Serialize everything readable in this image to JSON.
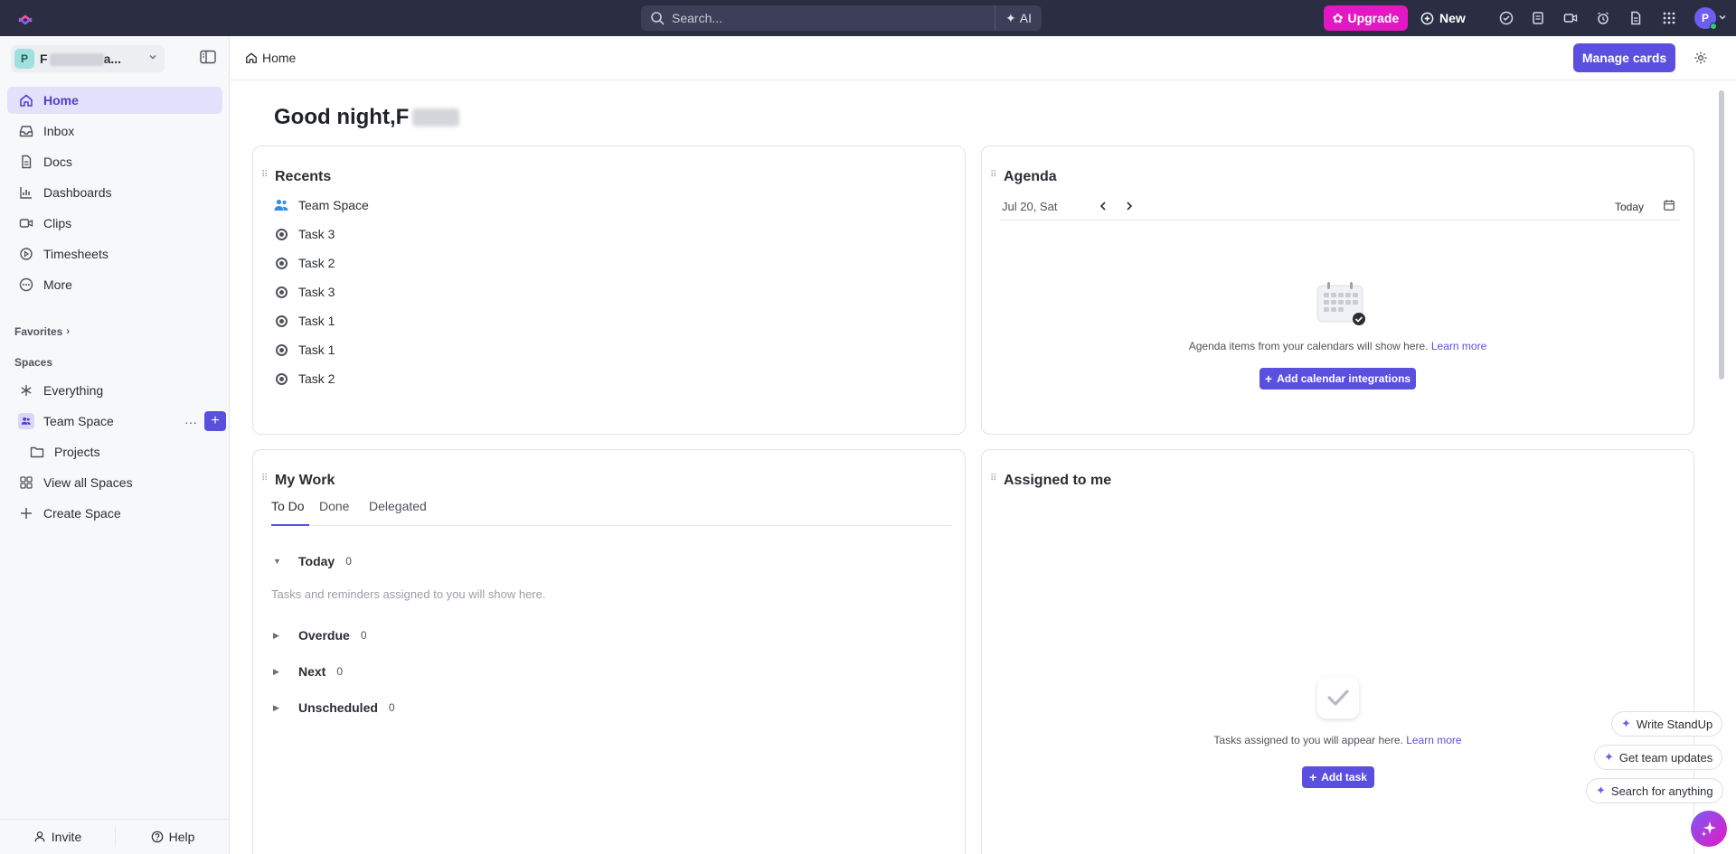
{
  "topbar": {
    "search_placeholder": "Search...",
    "ai_label": "AI",
    "upgrade_label": "Upgrade",
    "new_label": "New",
    "avatar_initial": "P"
  },
  "sidebar": {
    "workspace_initial": "P",
    "workspace_name_prefix": "F",
    "workspace_name_suffix": "a...",
    "nav": [
      {
        "label": "Home",
        "icon": "home-icon"
      },
      {
        "label": "Inbox",
        "icon": "inbox-icon"
      },
      {
        "label": "Docs",
        "icon": "docs-icon"
      },
      {
        "label": "Dashboards",
        "icon": "dashboard-icon"
      },
      {
        "label": "Clips",
        "icon": "video-icon"
      },
      {
        "label": "Timesheets",
        "icon": "timer-icon"
      },
      {
        "label": "More",
        "icon": "more-icon"
      }
    ],
    "favorites_label": "Favorites",
    "spaces_label": "Spaces",
    "spaces": {
      "everything": "Everything",
      "team_space": "Team Space",
      "projects": "Projects",
      "view_all": "View all Spaces",
      "create": "Create Space"
    },
    "invite_label": "Invite",
    "help_label": "Help"
  },
  "header": {
    "breadcrumb": "Home",
    "manage_cards": "Manage cards"
  },
  "greeting": {
    "text": "Good night, ",
    "name_initial": "F"
  },
  "recents": {
    "title": "Recents",
    "items": [
      {
        "label": "Team Space",
        "kind": "space"
      },
      {
        "label": "Task 3",
        "kind": "task"
      },
      {
        "label": "Task 2",
        "kind": "task"
      },
      {
        "label": "Task 3",
        "kind": "task"
      },
      {
        "label": "Task 1",
        "kind": "task"
      },
      {
        "label": "Task 1",
        "kind": "task"
      },
      {
        "label": "Task 2",
        "kind": "task"
      }
    ]
  },
  "agenda": {
    "title": "Agenda",
    "date": "Jul 20, Sat",
    "today_label": "Today",
    "empty_text": "Agenda items from your calendars will show here. ",
    "learn_more": "Learn more",
    "add_button": "Add calendar integrations"
  },
  "my_work": {
    "title": "My Work",
    "tabs": [
      "To Do",
      "Done",
      "Delegated"
    ],
    "groups": [
      {
        "label": "Today",
        "count": "0"
      },
      {
        "label": "Overdue",
        "count": "0"
      },
      {
        "label": "Next",
        "count": "0"
      },
      {
        "label": "Unscheduled",
        "count": "0"
      }
    ],
    "today_empty": "Tasks and reminders assigned to you will show here."
  },
  "assigned": {
    "title": "Assigned to me",
    "empty_text": "Tasks assigned to you will appear here. ",
    "learn_more": "Learn more",
    "add_button": "Add task"
  },
  "ai_actions": {
    "standup": "Write StandUp",
    "updates": "Get team updates",
    "search": "Search for anything"
  },
  "colors": {
    "accent": "#5b4fe0",
    "topbar": "#2b2d42",
    "upgrade": "#e318c3"
  }
}
